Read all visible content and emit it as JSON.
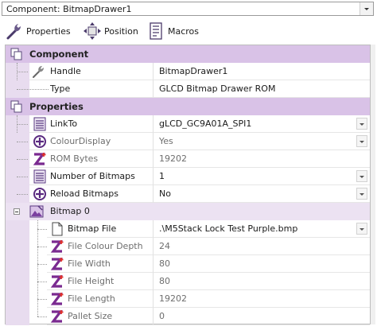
{
  "component_selector": {
    "value": "Component: BitmapDrawer1"
  },
  "toolbar": {
    "properties_label": "Properties",
    "position_label": "Position",
    "macros_label": "Macros"
  },
  "sections": {
    "component": {
      "title": "Component",
      "handle": {
        "name": "Handle",
        "value": "BitmapDrawer1"
      },
      "type": {
        "name": "Type",
        "value": "GLCD Bitmap Drawer ROM"
      }
    },
    "properties": {
      "title": "Properties",
      "linkto": {
        "name": "LinkTo",
        "value": "gLCD_GC9A01A_SPI1"
      },
      "colourdisplay": {
        "name": "ColourDisplay",
        "value": "Yes"
      },
      "rombytes": {
        "name": "ROM Bytes",
        "value": "19202"
      },
      "numbitmaps": {
        "name": "Number of Bitmaps",
        "value": "1"
      },
      "reloadbitmaps": {
        "name": "Reload Bitmaps",
        "value": "No"
      }
    },
    "bitmap0": {
      "title": "Bitmap 0",
      "file": {
        "name": "Bitmap File",
        "value": ".\\M5Stack Lock Test Purple.bmp"
      },
      "colourdepth": {
        "name": "File Colour Depth",
        "value": "24"
      },
      "width": {
        "name": "File Width",
        "value": "80"
      },
      "height": {
        "name": "File Height",
        "value": "80"
      },
      "length": {
        "name": "File Length",
        "value": "19202"
      },
      "pallet": {
        "name": "Pallet Size",
        "value": "0"
      }
    }
  },
  "colors": {
    "category_bg": "#d9c2e7",
    "accent_purple": "#7b3fa0",
    "z_red": "#e0302a"
  },
  "icons": [
    "wrench-icon",
    "move-arrows-icon",
    "macros-icon",
    "component-icon",
    "list-icon",
    "plus-circle-icon",
    "z-icon",
    "file-icon",
    "bitmap-icon"
  ]
}
